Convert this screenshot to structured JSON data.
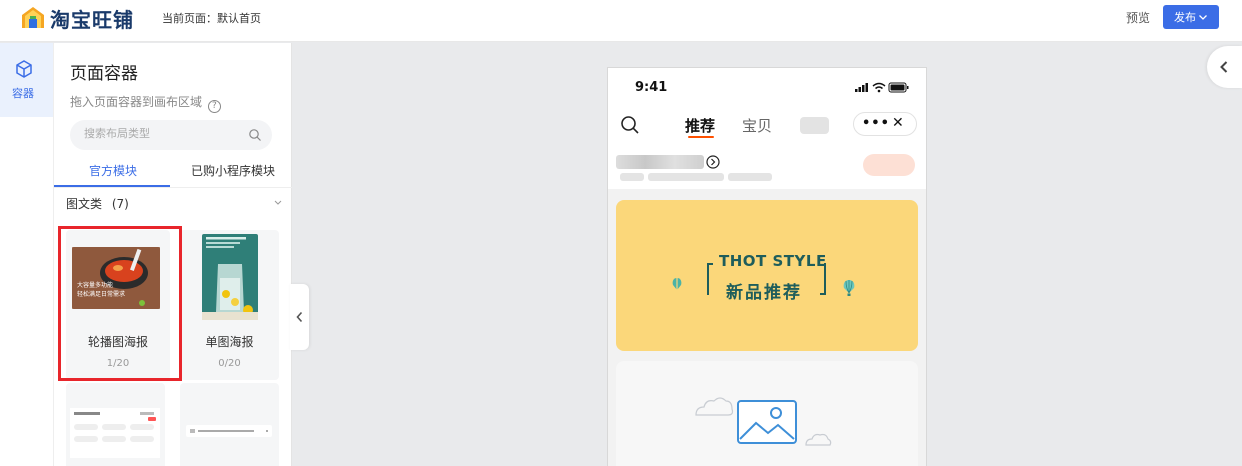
{
  "header": {
    "brand": "淘宝旺铺",
    "current_page": "当前页面：默认首页",
    "preview_label": "预览",
    "publish_label": "发布"
  },
  "rail": {
    "container_label": "容器"
  },
  "panel": {
    "title": "页面容器",
    "hint": "拖入页面容器到画布区域",
    "search_placeholder": "搜索布局类型",
    "tabs": [
      {
        "label": "官方模块",
        "active": true
      },
      {
        "label": "已购小程序模块",
        "active": false
      }
    ],
    "category": {
      "label": "图文类",
      "count": "(7)"
    },
    "modules": [
      {
        "label": "轮播图海报",
        "count": "1/20",
        "thumb_text": "大容量多功能\n轻松满足日常需求"
      },
      {
        "label": "单图海报",
        "count": "0/20"
      }
    ]
  },
  "phone": {
    "time": "9:41",
    "tab_recommend": "推荐",
    "tab_goods": "宝贝",
    "more": "•••",
    "close": "✕",
    "banner_en": "THOT STYLE",
    "banner_cn": "新品推荐"
  },
  "colors": {
    "accent": "#3b6de6",
    "selection": "#e8252b",
    "banner": "#fbd77a",
    "banner_text": "#1e5d5b",
    "tab_underline": "#ff5000"
  }
}
